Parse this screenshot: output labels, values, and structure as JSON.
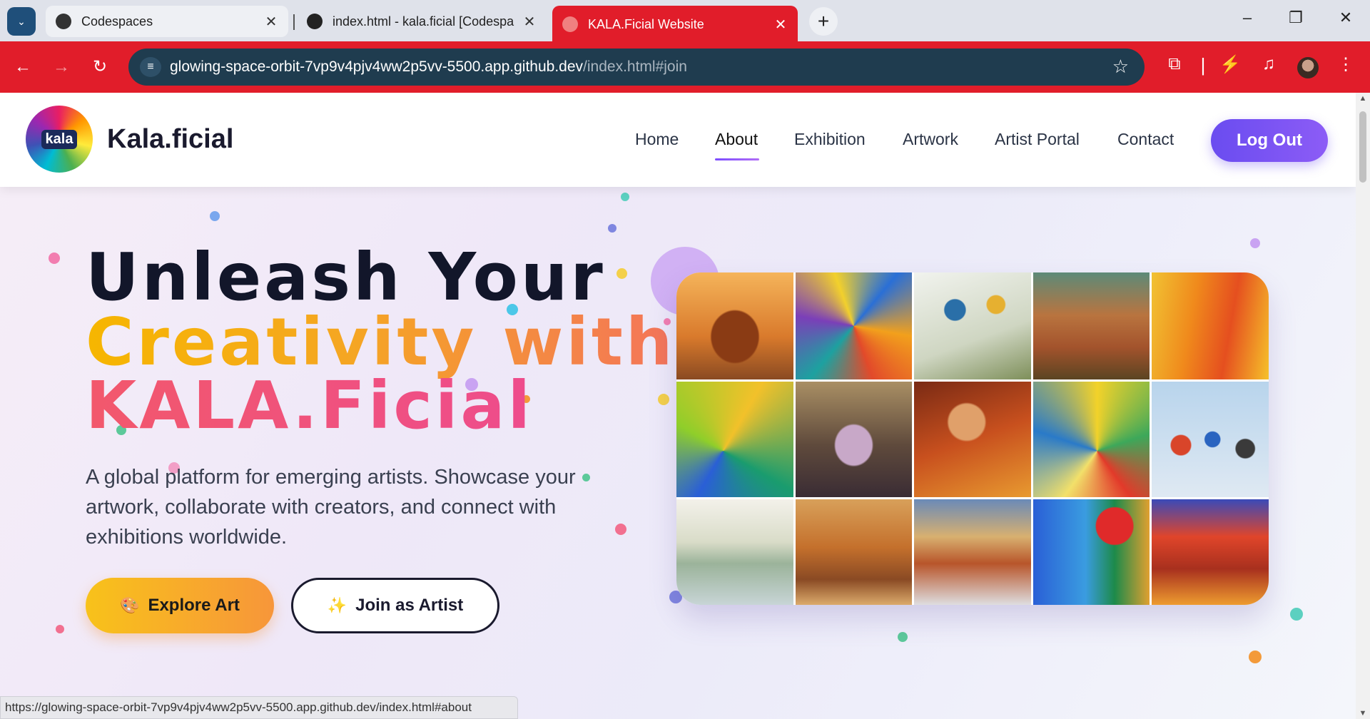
{
  "browser": {
    "tabs": [
      {
        "title": "Codespaces",
        "icon": "github-icon"
      },
      {
        "title": "index.html - kala.ficial [Codespa",
        "icon": "github-icon"
      },
      {
        "title": "KALA.Ficial Website",
        "icon": "globe-icon",
        "active": true
      }
    ],
    "url_host": "glowing-space-orbit-7vp9v4pjv4ww2p5vv-5500.app.github.dev",
    "url_path": "/index.html#join",
    "status_url": "https://glowing-space-orbit-7vp9v4pjv4ww2p5vv-5500.app.github.dev/index.html#about",
    "accent_color": "#e11d2a"
  },
  "header": {
    "logo_text": "kala",
    "brand": "Kala.ficial",
    "nav": [
      "Home",
      "About",
      "Exhibition",
      "Artwork",
      "Artist Portal",
      "Contact"
    ],
    "active_nav": "About",
    "logout_label": "Log Out"
  },
  "hero": {
    "line1": "Unleash Your",
    "line2": "Creativity with",
    "line3": "KALA.Ficial",
    "description": "A global platform for emerging artists. Showcase your artwork, collaborate with creators, and connect with exhibitions worldwide.",
    "explore_label": "Explore Art",
    "join_label": "Join as Artist"
  },
  "gallery": {
    "images": [
      "meditating-sage",
      "colorful-woman-painting",
      "birds-on-branch",
      "palace-at-sunset",
      "dancing-women",
      "peacocks",
      "woman-in-sari",
      "woman-with-diya",
      "bullock-cart",
      "birds-on-wire",
      "lakeside-palace",
      "village-market",
      "varanasi-ghats",
      "two-faces",
      "colorful-temple"
    ]
  }
}
